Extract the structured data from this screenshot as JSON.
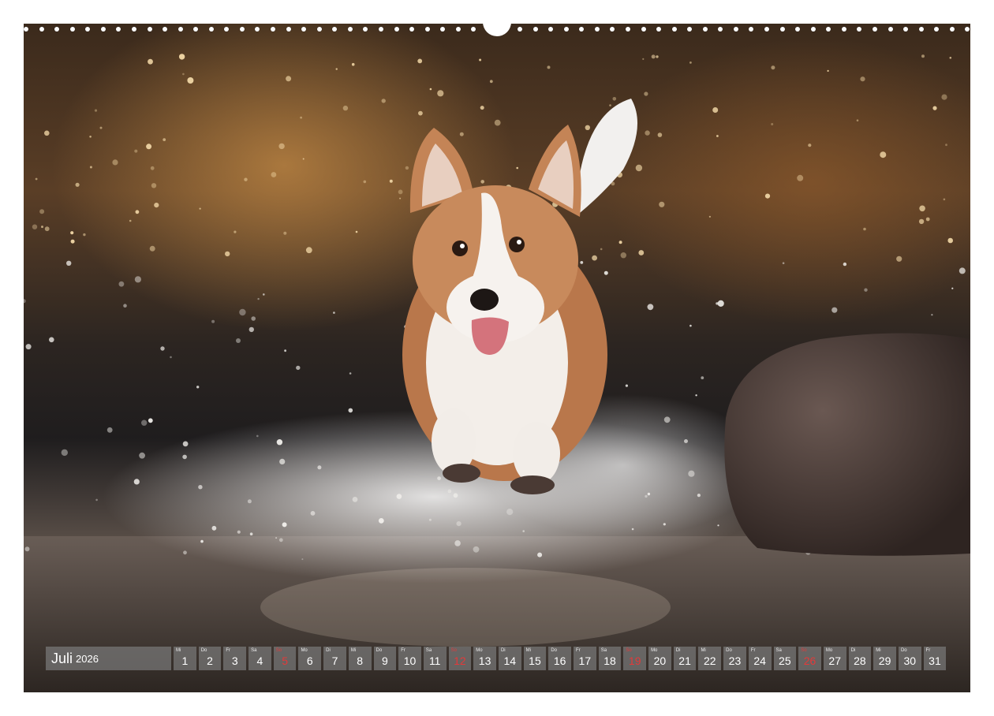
{
  "calendar": {
    "month": "Juli",
    "year": "2026",
    "days": [
      {
        "wd": "Mi",
        "num": "1",
        "sunday": false
      },
      {
        "wd": "Do",
        "num": "2",
        "sunday": false
      },
      {
        "wd": "Fr",
        "num": "3",
        "sunday": false
      },
      {
        "wd": "Sa",
        "num": "4",
        "sunday": false
      },
      {
        "wd": "So",
        "num": "5",
        "sunday": true
      },
      {
        "wd": "Mo",
        "num": "6",
        "sunday": false
      },
      {
        "wd": "Di",
        "num": "7",
        "sunday": false
      },
      {
        "wd": "Mi",
        "num": "8",
        "sunday": false
      },
      {
        "wd": "Do",
        "num": "9",
        "sunday": false
      },
      {
        "wd": "Fr",
        "num": "10",
        "sunday": false
      },
      {
        "wd": "Sa",
        "num": "11",
        "sunday": false
      },
      {
        "wd": "So",
        "num": "12",
        "sunday": true
      },
      {
        "wd": "Mo",
        "num": "13",
        "sunday": false
      },
      {
        "wd": "Di",
        "num": "14",
        "sunday": false
      },
      {
        "wd": "Mi",
        "num": "15",
        "sunday": false
      },
      {
        "wd": "Do",
        "num": "16",
        "sunday": false
      },
      {
        "wd": "Fr",
        "num": "17",
        "sunday": false
      },
      {
        "wd": "Sa",
        "num": "18",
        "sunday": false
      },
      {
        "wd": "So",
        "num": "19",
        "sunday": true
      },
      {
        "wd": "Mo",
        "num": "20",
        "sunday": false
      },
      {
        "wd": "Di",
        "num": "21",
        "sunday": false
      },
      {
        "wd": "Mi",
        "num": "22",
        "sunday": false
      },
      {
        "wd": "Do",
        "num": "23",
        "sunday": false
      },
      {
        "wd": "Fr",
        "num": "24",
        "sunday": false
      },
      {
        "wd": "Sa",
        "num": "25",
        "sunday": false
      },
      {
        "wd": "So",
        "num": "26",
        "sunday": true
      },
      {
        "wd": "Mo",
        "num": "27",
        "sunday": false
      },
      {
        "wd": "Di",
        "num": "28",
        "sunday": false
      },
      {
        "wd": "Mi",
        "num": "29",
        "sunday": false
      },
      {
        "wd": "Do",
        "num": "30",
        "sunday": false
      },
      {
        "wd": "Fr",
        "num": "31",
        "sunday": false
      }
    ]
  },
  "colors": {
    "sunday_text": "#e23a3a",
    "strip_box": "#787878"
  }
}
